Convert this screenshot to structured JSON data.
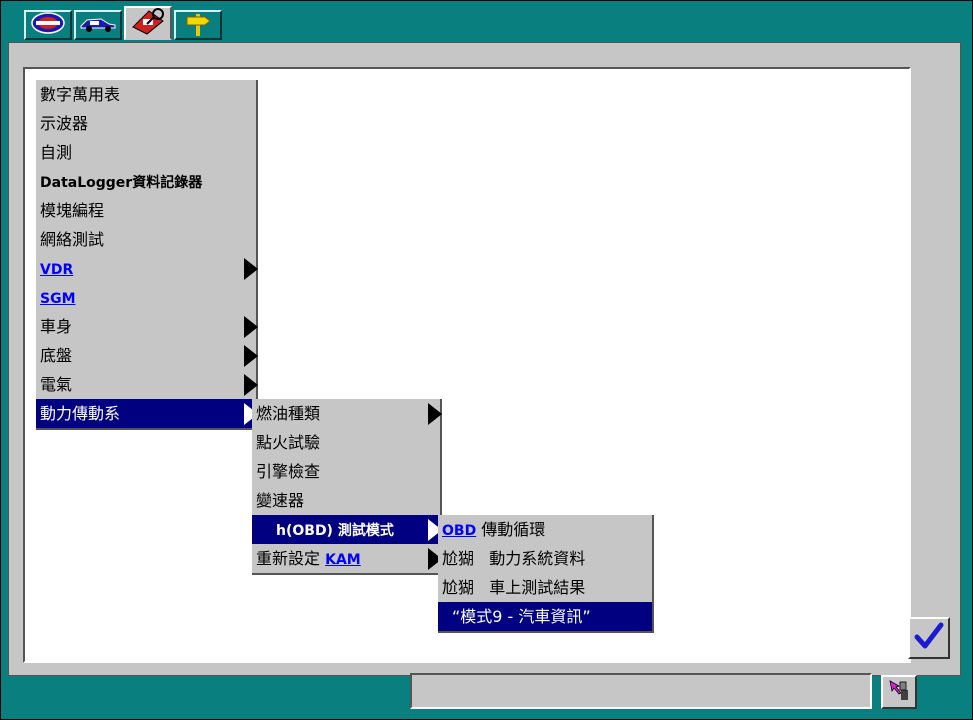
{
  "tabs": [
    {
      "icon": "vehicle-badge-icon"
    },
    {
      "icon": "car-icon"
    },
    {
      "icon": "toolbox-icon"
    },
    {
      "icon": "signpost-icon"
    }
  ],
  "menu1": {
    "items": [
      {
        "label": "數字萬用表"
      },
      {
        "label": "示波器"
      },
      {
        "label": "自測"
      },
      {
        "label": "DataLogger資料記錄器"
      },
      {
        "label": "模塊編程"
      },
      {
        "label": "網絡測試"
      },
      {
        "label": "VDR"
      },
      {
        "label": "SGM"
      },
      {
        "label": "車身"
      },
      {
        "label": "底盤"
      },
      {
        "label": "電氣"
      },
      {
        "label": "動力傳動系"
      }
    ]
  },
  "menu2": {
    "items": [
      {
        "label": "燃油種類"
      },
      {
        "label": "點火試驗"
      },
      {
        "label": "引擎檢查"
      },
      {
        "label": "變速器"
      },
      {
        "label": "h(OBD) 測試模式"
      },
      {
        "label_prefix": "重新設定 ",
        "label_link": "KAM"
      }
    ]
  },
  "menu3": {
    "items": [
      {
        "label_link": "OBD",
        "label_suffix": " 傳動循環"
      },
      {
        "label": "尬猢   動力系統資料"
      },
      {
        "label": "尬猢   車上測試結果"
      },
      {
        "label": "“模式9 - 汽車資訊”"
      }
    ]
  },
  "buttons": {
    "ok": "checkmark-icon",
    "aux": "cursor-tool-icon"
  },
  "status": {
    "text": ""
  },
  "colors": {
    "background": "#0a7f7f",
    "panel": "#c6c6c6",
    "selection": "#000080",
    "link": "#0000ff"
  }
}
